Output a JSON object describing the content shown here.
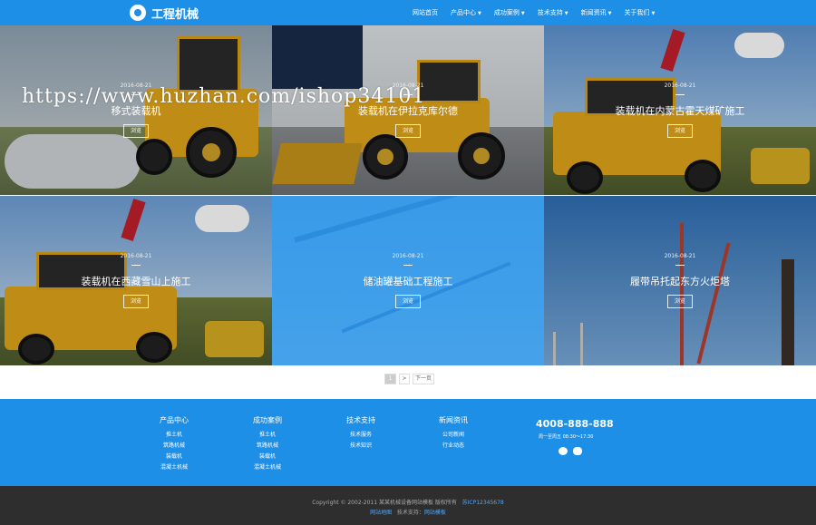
{
  "header": {
    "logo_text": "工程机械",
    "nav": [
      {
        "label": "网站首页",
        "dropdown": false
      },
      {
        "label": "产品中心",
        "dropdown": true
      },
      {
        "label": "成功案例",
        "dropdown": true
      },
      {
        "label": "技术支持",
        "dropdown": true
      },
      {
        "label": "新闻资讯",
        "dropdown": true
      },
      {
        "label": "关于我们",
        "dropdown": true
      }
    ]
  },
  "watermark": "https://www.huzhan.com/ishop34101",
  "cases": [
    {
      "date": "2016-08-21",
      "title": "移式装载机",
      "more": "浏览"
    },
    {
      "date": "2016-08-21",
      "title": "装载机在伊拉克库尔德",
      "more": "浏览"
    },
    {
      "date": "2016-08-21",
      "title": "装载机在内蒙古霍天煤矿施工",
      "more": "浏览"
    },
    {
      "date": "2016-08-21",
      "title": "装载机在西藏雪山上施工",
      "more": "浏览"
    },
    {
      "date": "2016-08-21",
      "title": "储油罐基础工程施工",
      "more": "浏览"
    },
    {
      "date": "2016-08-21",
      "title": "履带吊托起东方火炬塔",
      "more": "浏览"
    }
  ],
  "pager": {
    "current": "1",
    "next_symbol": ">",
    "next_label": "下一页"
  },
  "footer": {
    "columns": [
      {
        "title": "产品中心",
        "links": [
          "推土机",
          "筑路机械",
          "装载机",
          "混凝土机械"
        ]
      },
      {
        "title": "成功案例",
        "links": [
          "推土机",
          "筑路机械",
          "装载机",
          "混凝土机械"
        ]
      },
      {
        "title": "技术支持",
        "links": [
          "技术服务",
          "技术知识"
        ]
      },
      {
        "title": "新闻资讯",
        "links": [
          "公司新闻",
          "行业动态"
        ]
      }
    ],
    "phone": "4008-888-888",
    "hours": "周一至周五 08:30～17:30"
  },
  "bottom": {
    "copyright": "Copyright © 2002-2011 某某机械设备网站模板 版权所有",
    "icp": "苏ICP12345678",
    "sitemap": "网站地图",
    "support_label": "技术支持：",
    "support_link": "网站模板"
  },
  "colors": {
    "brand": "#1e8fe6",
    "footer_dark": "#2e2e2e"
  }
}
